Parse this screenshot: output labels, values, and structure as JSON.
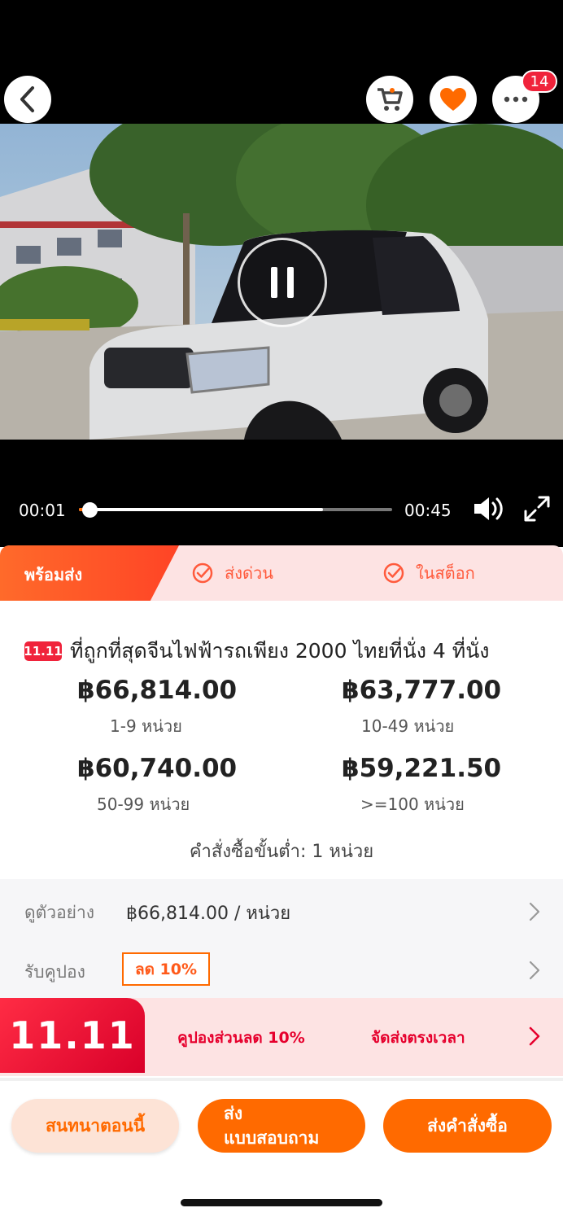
{
  "header": {
    "badge_count": "14"
  },
  "video": {
    "current_time": "00:01",
    "total_time": "00:45",
    "progress": 0.02
  },
  "shipping_tabs": [
    {
      "label": "พร้อมส่ง",
      "active": true
    },
    {
      "label": "ส่งด่วน",
      "active": false
    },
    {
      "label": "ในสต็อก",
      "active": false
    }
  ],
  "product": {
    "promo_tag": "11.11",
    "title": "ที่ถูกที่สุดจีนไฟฟ้ารถเพียง 2000 ไทยที่นั่ง 4 ที่นั่ง",
    "price_tiers": [
      {
        "price": "฿66,814.00",
        "qty": "1-9  หน่วย"
      },
      {
        "price": "฿63,777.00",
        "qty": "10-49  หน่วย"
      },
      {
        "price": "฿60,740.00",
        "qty": "50-99  หน่วย"
      },
      {
        "price": "฿59,221.50",
        "qty": ">=100  หน่วย"
      }
    ],
    "moq": "คำสั่งซื้อขั้นต่ำ: 1 หน่วย"
  },
  "sample": {
    "label": "ดูตัวอย่าง",
    "value": "฿66,814.00 / หน่วย"
  },
  "coupon": {
    "label": "รับคูปอง",
    "tag": "ลด 10%"
  },
  "promo_banner": {
    "logo": "11.11",
    "coupon_text": "คูปองส่วนลด 10%",
    "delivery_text": "จัดส่งตรงเวลา"
  },
  "actions": {
    "chat": "สนทนาตอนนี้",
    "inquiry_line1": "ส่ง",
    "inquiry_line2": "แบบสอบถาม",
    "order": "ส่งคำสั่งซื้อ"
  },
  "colors": {
    "accent": "#ff6a00",
    "promo_red": "#f0233b",
    "tab_bg": "#fde3e3"
  }
}
